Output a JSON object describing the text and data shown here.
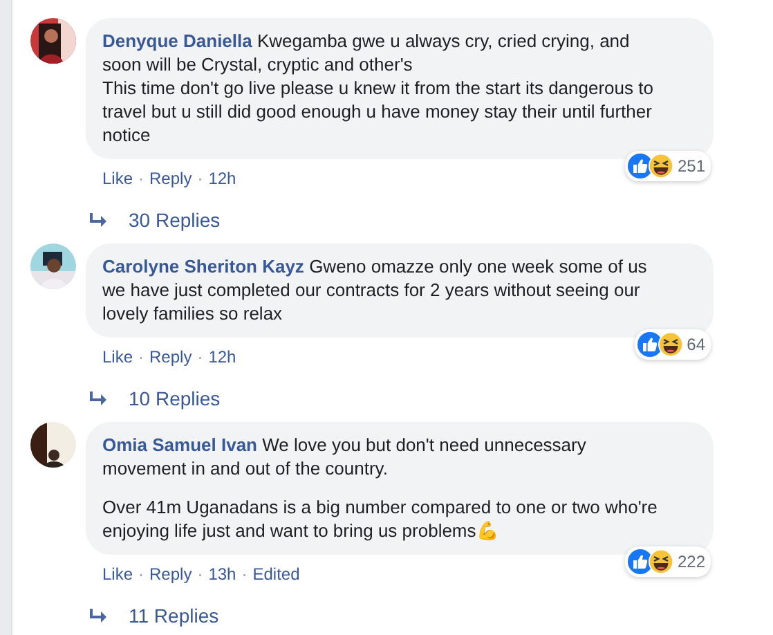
{
  "comments": [
    {
      "author": "Denyque Daniella",
      "paragraphs": [
        "Kwegamba gwe u always cry, cried crying, and soon will be Crystal, cryptic and other's\nThis time don't go live please u knew it from the start its dangerous to travel but u still did good enough u have money stay their until further notice"
      ],
      "separator": "·",
      "reaction_count": "251",
      "actions": [
        "Like",
        "Reply"
      ],
      "time": "12h",
      "replies": "30 Replies"
    },
    {
      "author": "Carolyne Sheriton Kayz",
      "paragraphs": [
        "Gweno omazze only one week some of us we have just completed our contracts for 2 years without seeing our lovely families so relax"
      ],
      "separator": "·",
      "reaction_count": "64",
      "actions": [
        "Like",
        "Reply"
      ],
      "time": "12h",
      "replies": "10 Replies"
    },
    {
      "author": "Omia Samuel Ivan",
      "paragraphs": [
        "We love you but don't need unnecessary movement in and out of the country.",
        "Over 41m Uganadans is a big number compared to one or two who're enjoying life just and want to bring us problems💪"
      ],
      "separator": "·",
      "reaction_count": "222",
      "actions": [
        "Like",
        "Reply"
      ],
      "time": "13h",
      "edited_label": "Edited",
      "replies": "11 Replies"
    }
  ]
}
